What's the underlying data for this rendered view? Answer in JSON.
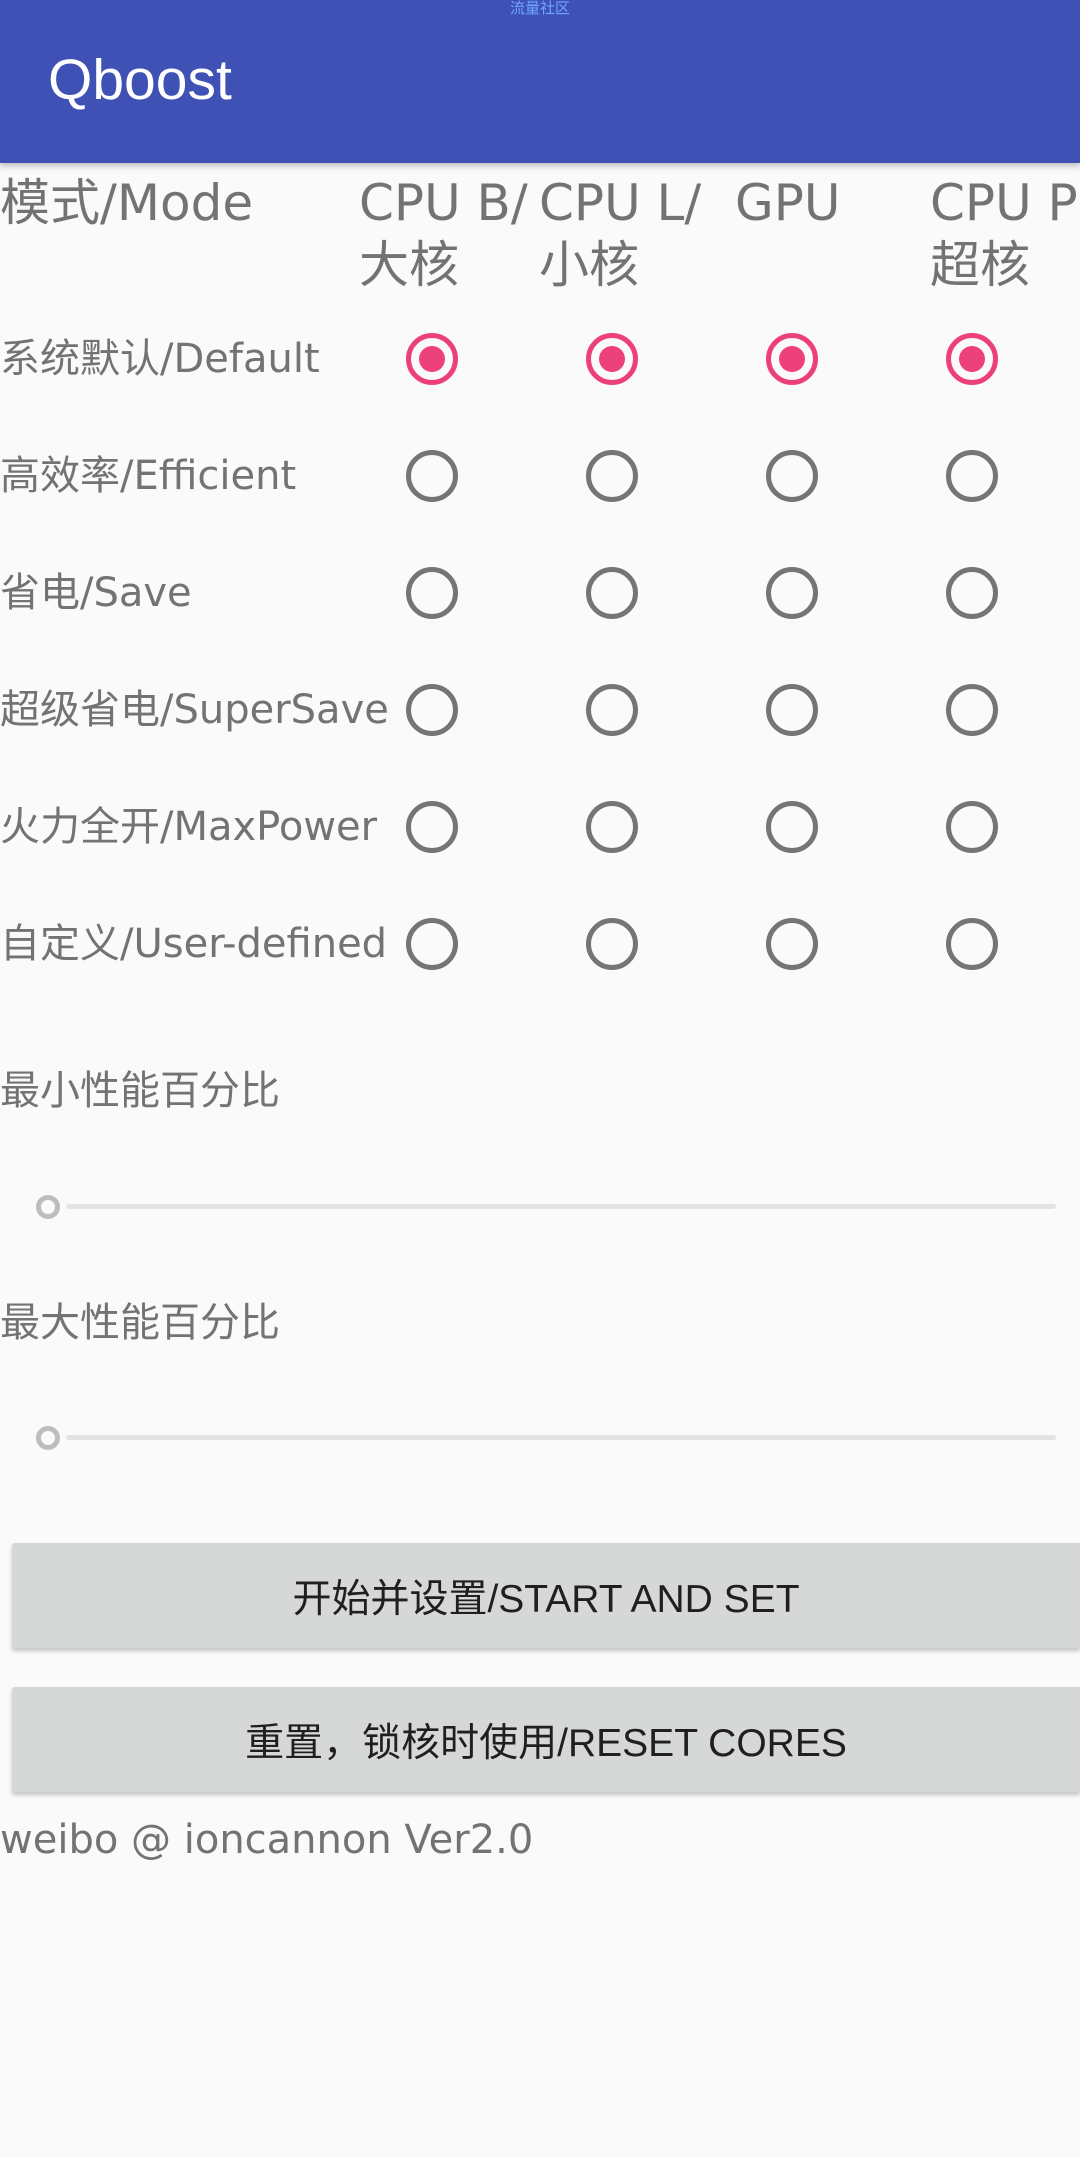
{
  "watermark": "流量社区",
  "app": {
    "title": "Qboost"
  },
  "columns": [
    {
      "id": "cpu-big",
      "label": "CPU B/\n大核"
    },
    {
      "id": "cpu-little",
      "label": "CPU L/\n小核"
    },
    {
      "id": "gpu",
      "label": "GPU"
    },
    {
      "id": "cpu-prime",
      "label": "CPU P\n超核"
    }
  ],
  "mode_header": "模式/Mode",
  "modes": [
    {
      "label": "系统默认/Default",
      "selected": [
        true,
        true,
        true,
        true
      ]
    },
    {
      "label": "高效率/Efficient",
      "selected": [
        false,
        false,
        false,
        false
      ]
    },
    {
      "label": "省电/Save",
      "selected": [
        false,
        false,
        false,
        false
      ]
    },
    {
      "label": "超级省电/SuperSave",
      "selected": [
        false,
        false,
        false,
        false
      ]
    },
    {
      "label": "火力全开/MaxPower",
      "selected": [
        false,
        false,
        false,
        false
      ]
    },
    {
      "label": "自定义/User-defined",
      "selected": [
        false,
        false,
        false,
        false
      ]
    }
  ],
  "min_perf": {
    "label": "最小性能百分比",
    "value_fraction": 0
  },
  "max_perf": {
    "label": "最大性能百分比",
    "value_fraction": 0
  },
  "buttons": {
    "start": "开始并设置/START AND SET",
    "reset": "重置，锁核时使用/RESET CORES"
  },
  "footer": "weibo @ ioncannon Ver2.0"
}
